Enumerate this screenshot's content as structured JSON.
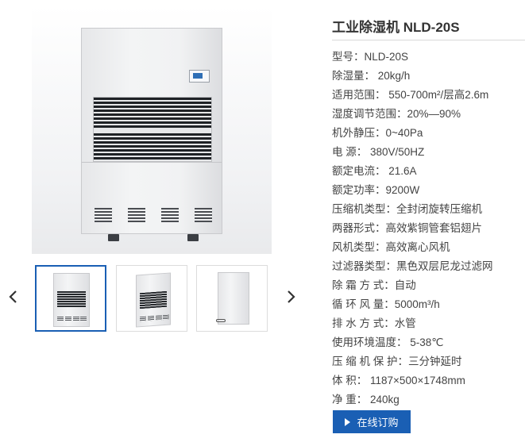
{
  "product": {
    "title": "工业除湿机 NLD-20S"
  },
  "specs": [
    {
      "label": "型号：",
      "value": "NLD-20S"
    },
    {
      "label": "除湿量： ",
      "value": "20kg/h"
    },
    {
      "label": "适用范围：",
      "value": " 550-700m²/层高2.6m"
    },
    {
      "label": "湿度调节范围：",
      "value": "20%—90%"
    },
    {
      "label": "机外静压：",
      "value": "0~40Pa"
    },
    {
      "label": "电 源：",
      "value": " 380V/50HZ"
    },
    {
      "label": "额定电流：",
      "value": " 21.6A"
    },
    {
      "label": "额定功率：",
      "value": "9200W"
    },
    {
      "label": "压缩机类型：",
      "value": "全封闭旋转压缩机"
    },
    {
      "label": "两器形式：",
      "value": "高效紫铜管套铝翅片"
    },
    {
      "label": "风机类型：",
      "value": "高效离心风机"
    },
    {
      "label": "过滤器类型：",
      "value": "黑色双层尼龙过滤网"
    },
    {
      "label": "除 霜 方 式：",
      "value": "自动"
    },
    {
      "label": "循 环 风 量：",
      "value": "5000m³/h"
    },
    {
      "label": "排 水 方 式：",
      "value": "水管"
    },
    {
      "label": "使用环境温度：",
      "value": " 5-38℃"
    },
    {
      "label": "压 缩 机 保 护：",
      "value": "三分钟延时"
    },
    {
      "label": "体 积：",
      "value": " 1187×500×1748mm"
    },
    {
      "label": "净 重：",
      "value": " 240kg"
    }
  ],
  "order_button": {
    "label": "在线订购",
    "icon": "play-icon"
  },
  "gallery": {
    "prev_icon": "chevron-left-icon",
    "next_icon": "chevron-right-icon",
    "active_index": 0,
    "thumbnail_count": 3
  },
  "colors": {
    "accent": "#1a5fb4",
    "text": "#444444",
    "title": "#333333"
  }
}
